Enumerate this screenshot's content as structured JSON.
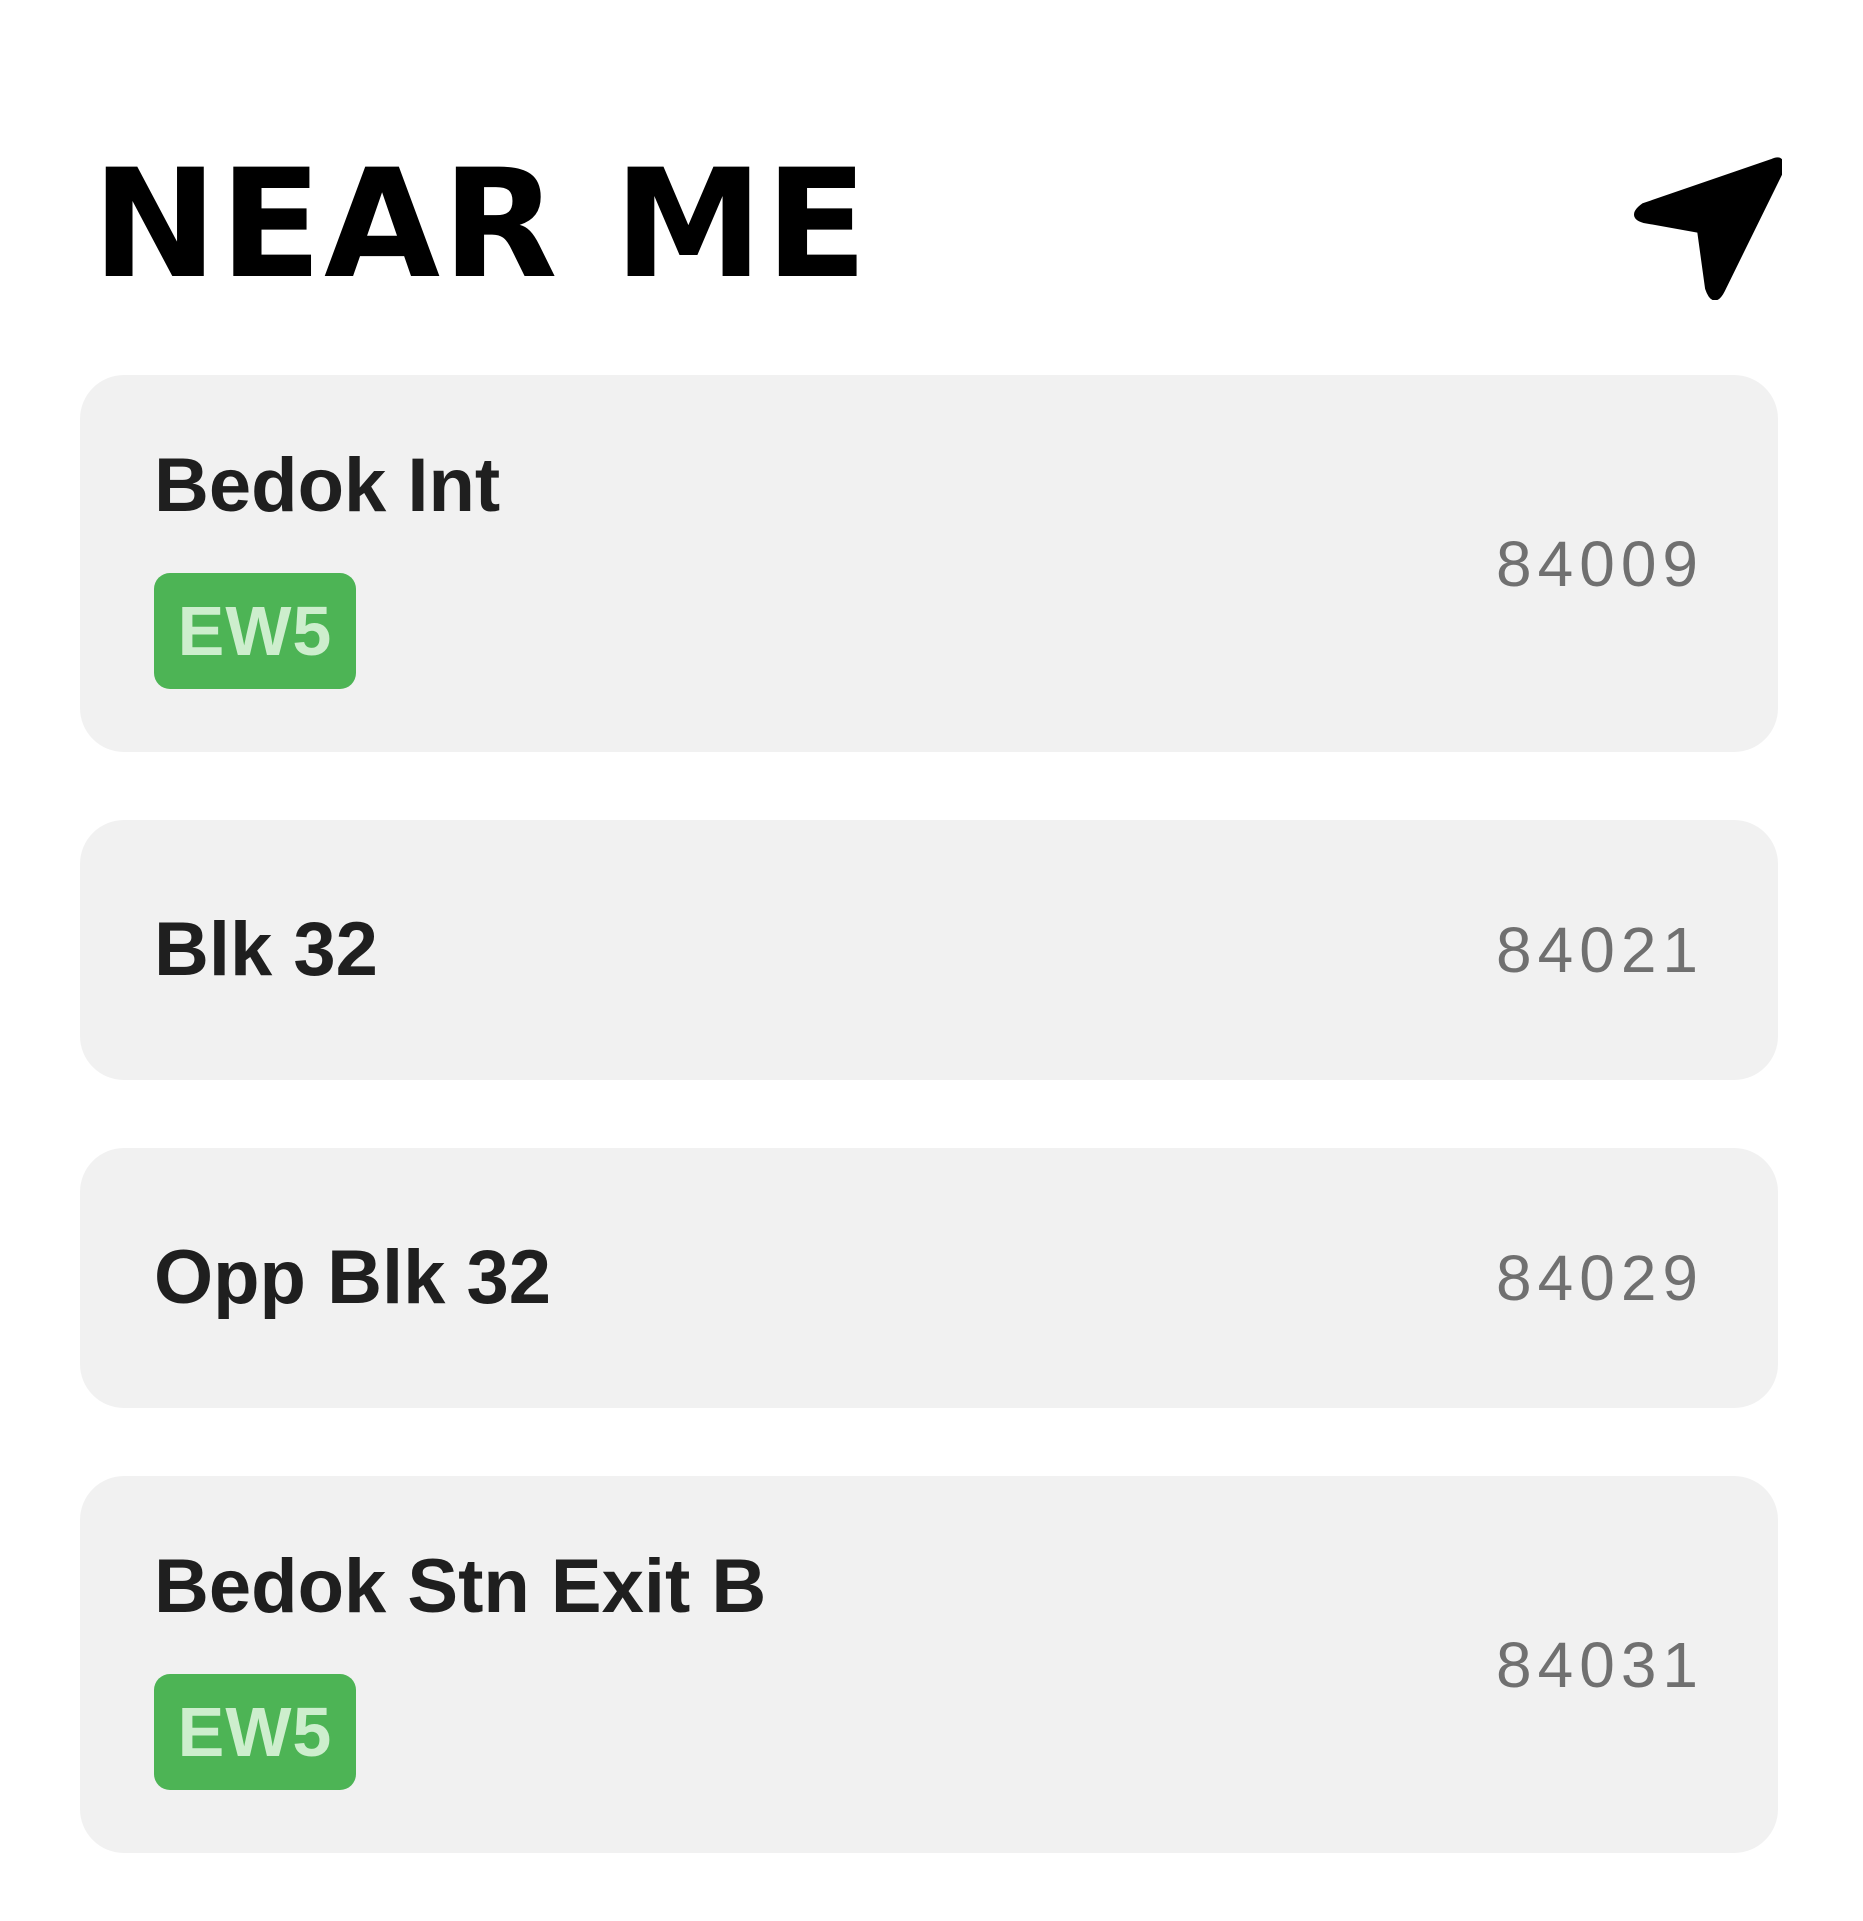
{
  "header": {
    "title": "NEAR ME",
    "locate_icon": "navigation-arrow-icon"
  },
  "colors": {
    "card_background": "#f1f1f1",
    "badge_background": "#4db455",
    "badge_text": "#cdeecd",
    "code_text": "#707070"
  },
  "stops": [
    {
      "name": "Bedok Int",
      "code": "84009",
      "badge": "EW5"
    },
    {
      "name": "Blk 32",
      "code": "84021"
    },
    {
      "name": "Opp Blk 32",
      "code": "84029"
    },
    {
      "name": "Bedok Stn Exit B",
      "code": "84031",
      "badge": "EW5"
    }
  ]
}
